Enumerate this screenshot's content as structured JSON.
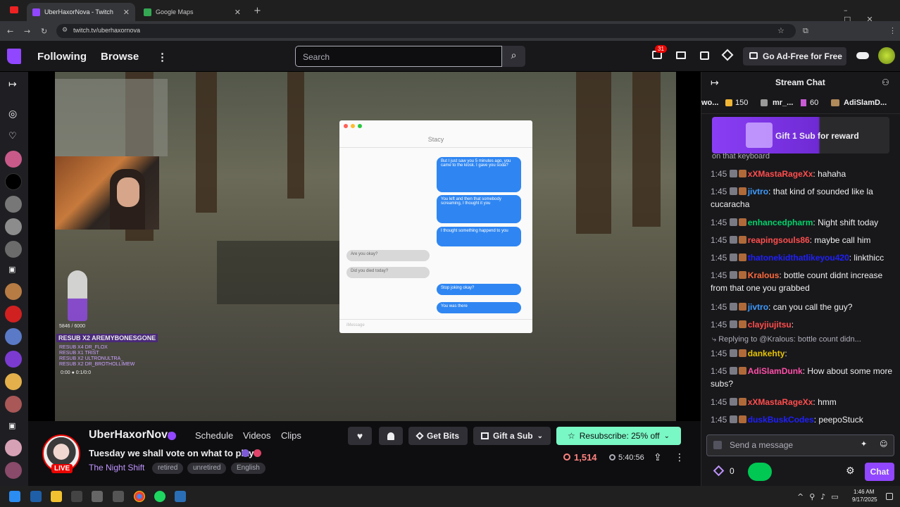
{
  "browser": {
    "tabs": [
      {
        "title": "UberHaxorNova - Twitch"
      },
      {
        "title": "Google Maps"
      }
    ],
    "url": "twitch.tv/uberhaxornova",
    "new_tab": "+"
  },
  "nav": {
    "following": "Following",
    "browse": "Browse",
    "more": "⋮",
    "search_placeholder": "Search",
    "notif_count": "31",
    "ad_free": "Go Ad-Free for Free"
  },
  "stream": {
    "channel": "UberHaxorNova",
    "live": "LIVE",
    "tabs": [
      "Schedule",
      "Videos",
      "Clips"
    ],
    "title": "Tuesday we shall vote on what to play",
    "game": "The Night Shift",
    "tags": [
      "retired",
      "unretired",
      "English"
    ],
    "viewers": "1,514",
    "uptime": "5:40:56",
    "get_bits": "Get Bits",
    "gift_sub": "Gift a Sub",
    "resub": "Resubscribe: 25% off"
  },
  "game_ui": {
    "contact": "Stacy",
    "messages_me": [
      "But I just saw you 5 minutes ago, you came to the kiosk. I gave you soda?",
      "You left and then that somebody screaming, I thought it you",
      "I thought something happend to you",
      "Stop joking okay?",
      "You was there"
    ],
    "messages_them": [
      "Are you okay?",
      "Did you died today?"
    ],
    "input": "iMessage"
  },
  "overlay": {
    "counter": "5846 / 6000",
    "resub_banner": "RESUB X2 AREMYBONESGONE",
    "resubs": [
      "RESUB X4 DR_FLOX",
      "RESUB X1 TRIST",
      "RESUB X2 ULTRONULTRA_",
      "RESUB X2 DR_BROTHOLLIMEW"
    ],
    "footer": "0:00 ● 0:1/0:0"
  },
  "chat": {
    "title": "Stream Chat",
    "leaderboard": [
      {
        "name": "wo...",
        "amount": "150"
      },
      {
        "name": "mr_...",
        "amount": "60"
      },
      {
        "name": "AdiSlamD...",
        "amount": ""
      }
    ],
    "gift_banner": "Gift 1 Sub for reward",
    "partial_top": "on that keyboard",
    "messages": [
      {
        "time": "1:45",
        "user": "xXMastaRageXx",
        "color": "#ff4d4d",
        "text": ": hahaha"
      },
      {
        "time": "1:45",
        "user": "jivtro",
        "color": "#3d9bff",
        "text": ": that kind of sounded like la cucaracha"
      },
      {
        "time": "1:45",
        "user": "enhancedpharm",
        "color": "#00d26a",
        "text": ": Night shift today"
      },
      {
        "time": "1:45",
        "user": "reapingsouls86",
        "color": "#ff4d4d",
        "text": ": maybe call him"
      },
      {
        "time": "1:45",
        "user": "thatonekidthatlikeyou420",
        "color": "#1f1fff",
        "text": ": linkthicc"
      },
      {
        "time": "1:45",
        "user": "Kralous",
        "color": "#ff6a3d",
        "text": ": bottle count didnt increase from that one you grabbed"
      },
      {
        "time": "1:45",
        "user": "jivtro",
        "color": "#3d9bff",
        "text": ": can you call the guy?"
      },
      {
        "time": "1:45",
        "user": "clayjiujitsu",
        "color": "#ff4d4d",
        "text": ":"
      },
      {
        "time": "1:45",
        "user": "dankehty",
        "color": "#e6c300",
        "text": ":"
      },
      {
        "time": "1:45",
        "user": "AdiSlamDunk",
        "color": "#ff4fa8",
        "text": ": How about some more subs?"
      },
      {
        "time": "1:45",
        "user": "xXMastaRageXx",
        "color": "#ff4d4d",
        "text": ": hmm"
      },
      {
        "time": "1:45",
        "user": "duskBuskCodes",
        "color": "#1f1fff",
        "text": ": peepoStuck"
      }
    ],
    "reply": "Replying to @Kralous: bottle count didn...",
    "input_placeholder": "Send a message",
    "points": "0",
    "chat_button": "Chat"
  },
  "taskbar": {
    "time": "1:46 AM",
    "date": "9/17/2025"
  }
}
